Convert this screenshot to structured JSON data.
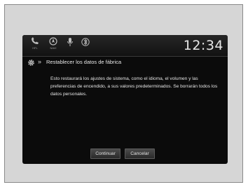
{
  "statusbar": {
    "icons": [
      {
        "name": "phone-icon",
        "label": "HFL"
      },
      {
        "name": "navigation-icon",
        "label": "NAVI"
      },
      {
        "name": "microphone-icon",
        "label": ""
      },
      {
        "name": "bluetooth-icon",
        "label": ""
      }
    ],
    "small_text": "",
    "clock": "12:34"
  },
  "dialog": {
    "title": "Restablecer los datos de fábrica",
    "message": "Esto restaurará los ajustes de sistema, como el idioma, el volumen y las preferencias de encendido, a sus valores predeterminados. Se borrarán todos los datos personales.",
    "continue_label": "Continuar",
    "cancel_label": "Cancelar"
  }
}
